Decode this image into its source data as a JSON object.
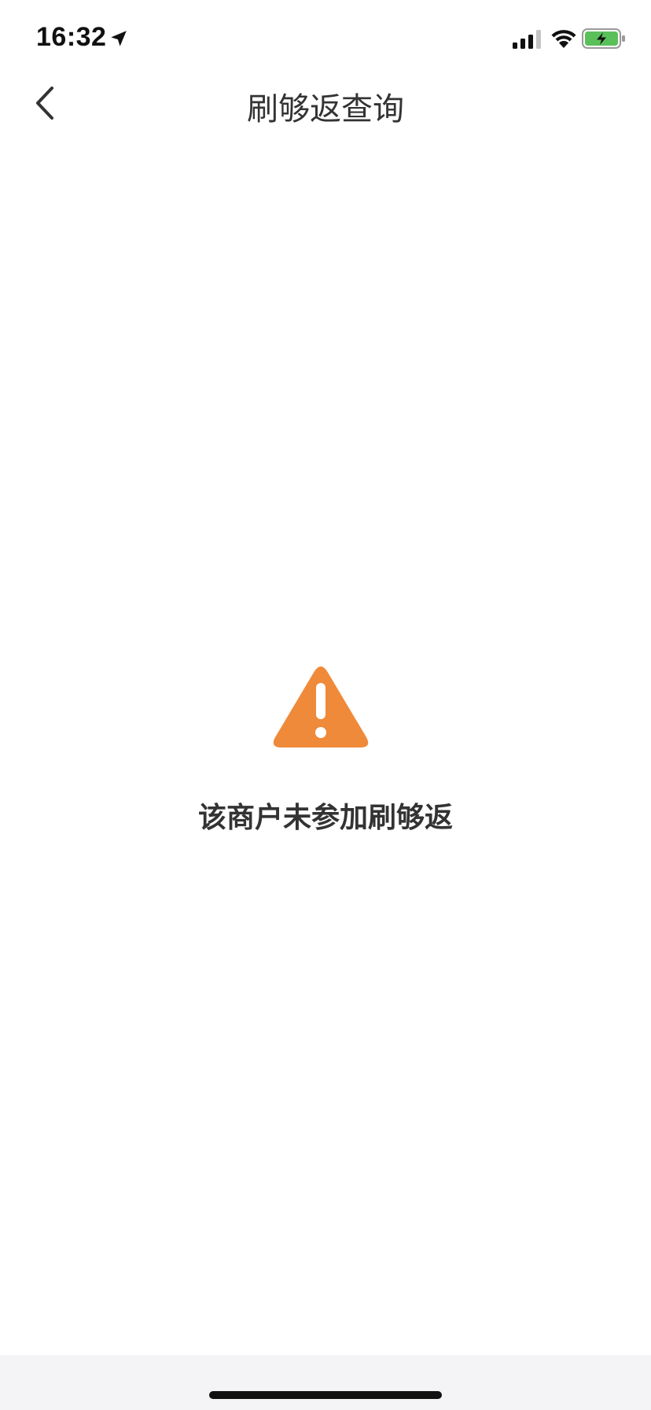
{
  "status_bar": {
    "time": "16:32",
    "icons": [
      "location-arrow-icon",
      "cellular-signal-icon",
      "wifi-icon",
      "battery-charging-icon"
    ],
    "battery_color": "#5ac05a"
  },
  "nav": {
    "back_icon": "chevron-left-icon",
    "title": "刷够返查询"
  },
  "empty_state": {
    "icon": "warning-icon",
    "icon_color": "#ef8a3a",
    "message": "该商户未参加刷够返"
  },
  "colors": {
    "background": "#ffffff",
    "text": "#333333",
    "home_bar_bg": "#f4f4f6"
  }
}
